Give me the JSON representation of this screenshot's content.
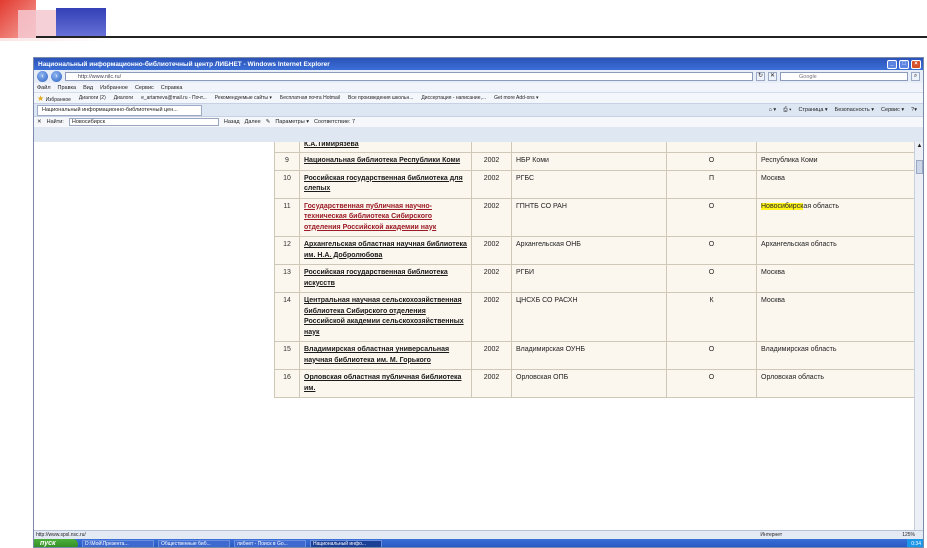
{
  "window": {
    "title": "Национальный информационно-библиотечный центр ЛИБНЕТ - Windows Internet Explorer",
    "address": "http://www.nilc.ru/",
    "search_placeholder": "Google",
    "menu": [
      "Файл",
      "Правка",
      "Вид",
      "Избранное",
      "Сервис",
      "Справка"
    ],
    "favorites": [
      "Избранное",
      "Диалоги (2)",
      "Диалоги",
      "e_artamevа@mail.ru - Почт...",
      "Рекомендуемые сайты ▾",
      "Бесплатная почта Hotmail",
      "Все произведения школьн...",
      "Диссертация - написание,...",
      "Get more Add-ons ▾"
    ],
    "tab": "Национальный информационно-библиотечный цен...",
    "commands": [
      "Страница ▾",
      "Безопасность ▾",
      "Сервис ▾"
    ],
    "find": {
      "close": "✕",
      "label": "Найти:",
      "value": "Новосибирск",
      "prev": "Назад",
      "next": "Далее",
      "options": "Параметры ▾",
      "matches": "Соответствие: 7"
    },
    "status": {
      "url": "http://www.spsl.nsc.ru/",
      "zone": "Интернет",
      "zoom": "125%"
    },
    "taskbar": {
      "start": "пуск",
      "tasks": [
        "D:\\Мой\\Презента...",
        "Общественные биб...",
        "либнет - Поиск в Go...",
        "Национальный инфо..."
      ],
      "clock": "0:34"
    }
  },
  "table": {
    "rows": [
      {
        "num": "",
        "name": "К.А.Тимирязева",
        "year": "",
        "abbr": "",
        "type": "",
        "region": ""
      },
      {
        "num": "9",
        "name": "Национальная библиотека Республики Коми",
        "year": "2002",
        "abbr": "НБР Коми",
        "type": "О",
        "region": "Республика Коми"
      },
      {
        "num": "10",
        "name": "Российская государственная библиотека для слепых",
        "year": "2002",
        "abbr": "РГБС",
        "type": "П",
        "region": "Москва"
      },
      {
        "num": "11",
        "name": "Государственная публичная научно-техническая библиотека Сибирского отделения Российской академии наук",
        "year": "2002",
        "abbr": "ГПНТБ СО РАН",
        "type": "О",
        "region_hl": "Новосибирск",
        "region": "ая область",
        "visited": true
      },
      {
        "num": "12",
        "name": "Архангельская областная научная библиотека им. Н.А. Добролюбова",
        "year": "2002",
        "abbr": "Архангельская ОНБ",
        "type": "О",
        "region": "Архангельская область"
      },
      {
        "num": "13",
        "name": "Российская государственная библиотека искусств",
        "year": "2002",
        "abbr": "РГБИ",
        "type": "О",
        "region": "Москва"
      },
      {
        "num": "14",
        "name": "Центральная научная сельскохозяйственная библиотека Сибирского отделения Российской академии сельскохозяйственных наук",
        "year": "2002",
        "abbr": "ЦНСХБ СО РАСХН",
        "type": "К",
        "region": "Москва"
      },
      {
        "num": "15",
        "name": "Владимирская областная универсальная научная библиотека им. М. Горького",
        "year": "2002",
        "abbr": "Владимирская ОУНБ",
        "type": "О",
        "region": "Владимирская область"
      },
      {
        "num": "16",
        "name": "Орловская областная публичная библиотека им.",
        "year": "2002",
        "abbr": "Орловская ОПБ",
        "type": "О",
        "region": "Орловская область"
      }
    ]
  },
  "colors": {
    "accent": "#2b53b8",
    "row_bg": "#fbf6ee",
    "highlight": "#fff41c",
    "visited_link": "#9b1a24"
  }
}
